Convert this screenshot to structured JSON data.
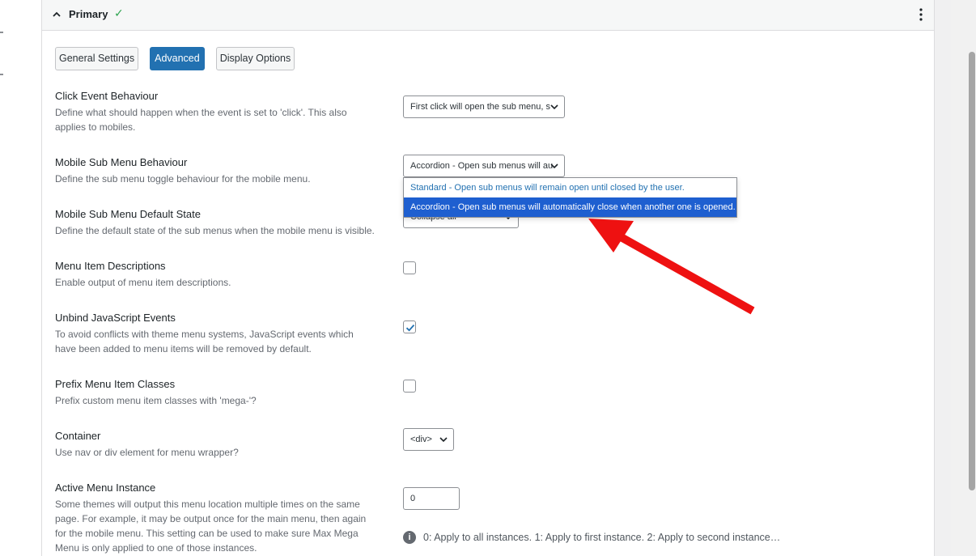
{
  "panel": {
    "title": "Primary",
    "status": "✓"
  },
  "tabs": [
    {
      "label": "General Settings",
      "active": false
    },
    {
      "label": "Advanced",
      "active": true
    },
    {
      "label": "Display Options",
      "active": false
    }
  ],
  "settings": {
    "click_event": {
      "label": "Click Event Behaviour",
      "desc": "Define what should happen when the event is set to 'click'. This also applies to mobiles.",
      "value": "First click will open the sub menu, s"
    },
    "mobile_sub_menu": {
      "label": "Mobile Sub Menu Behaviour",
      "desc": "Define the sub menu toggle behaviour for the mobile menu.",
      "value": "Accordion - Open sub menus will au",
      "options": [
        "Standard - Open sub menus will remain open until closed by the user.",
        "Accordion - Open sub menus will automatically close when another one is opened."
      ],
      "selected_index": 1
    },
    "mobile_default_state": {
      "label": "Mobile Sub Menu Default State",
      "desc": "Define the default state of the sub menus when the mobile menu is visible.",
      "value": "Collapse all"
    },
    "item_descriptions": {
      "label": "Menu Item Descriptions",
      "desc": "Enable output of menu item descriptions.",
      "checked": false
    },
    "unbind_js": {
      "label": "Unbind JavaScript Events",
      "desc": "To avoid conflicts with theme menu systems, JavaScript events which have been added to menu items will be removed by default.",
      "checked": true
    },
    "prefix_classes": {
      "label": "Prefix Menu Item Classes",
      "desc": "Prefix custom menu item classes with 'mega-'?",
      "checked": false
    },
    "container": {
      "label": "Container",
      "desc": "Use nav or div element for menu wrapper?",
      "value": "<div>"
    },
    "active_instance": {
      "label": "Active Menu Instance",
      "desc": "Some themes will output this menu location multiple times on the same page. For example, it may be output once for the main menu, then again for the mobile menu. This setting can be used to make sure Max Mega Menu is only applied to one of those instances.",
      "value": "0",
      "hint": "0: Apply to all instances. 1: Apply to first instance. 2: Apply to second instance…"
    }
  },
  "colors": {
    "accent": "#2271b1",
    "selected_option": "#1e5fd0",
    "annotation_arrow": "#ee1111",
    "check": "#2ea44f"
  }
}
